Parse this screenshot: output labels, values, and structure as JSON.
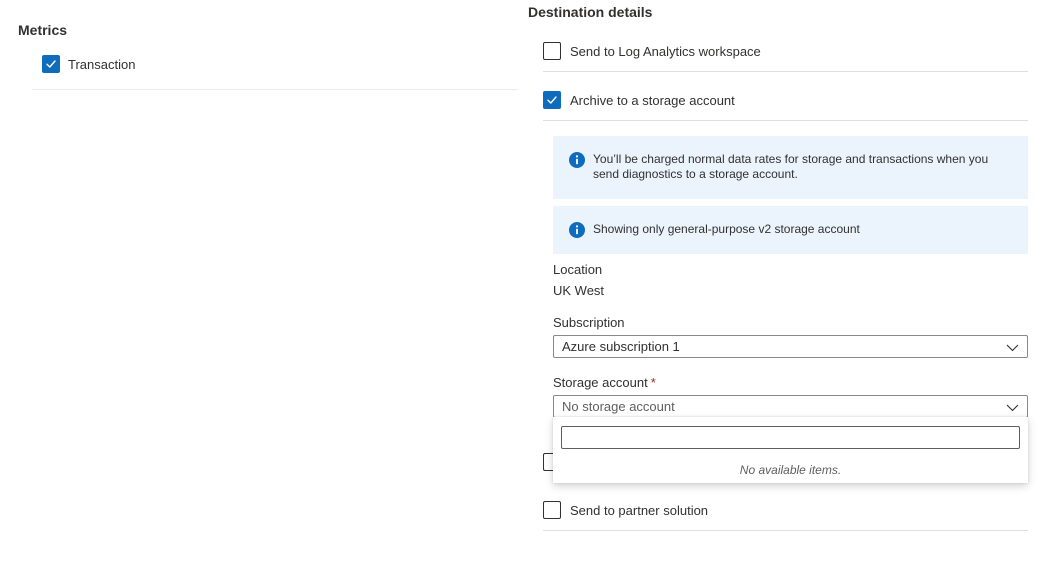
{
  "metrics": {
    "title": "Metrics",
    "items": [
      {
        "label": "Transaction",
        "checked": true
      }
    ]
  },
  "destination": {
    "title": "Destination details",
    "options": [
      {
        "label": "Send to Log Analytics workspace",
        "checked": false
      },
      {
        "label": "Archive to a storage account",
        "checked": true
      },
      {
        "label": "Send to partner solution",
        "checked": false
      }
    ],
    "info_messages": [
      "You’ll be charged normal data rates for storage and transactions when you send diagnostics to a storage account.",
      "Showing only general-purpose v2 storage account"
    ],
    "location": {
      "label": "Location",
      "value": "UK West"
    },
    "subscription": {
      "label": "Subscription",
      "value": "Azure subscription 1"
    },
    "storage_account": {
      "label": "Storage account",
      "required_marker": "*",
      "value": "No storage account",
      "search_value": "",
      "empty_message": "No available items."
    }
  },
  "colors": {
    "accent": "#0f6cbd",
    "info_background": "#ebf3fc",
    "required": "#a4262c"
  }
}
